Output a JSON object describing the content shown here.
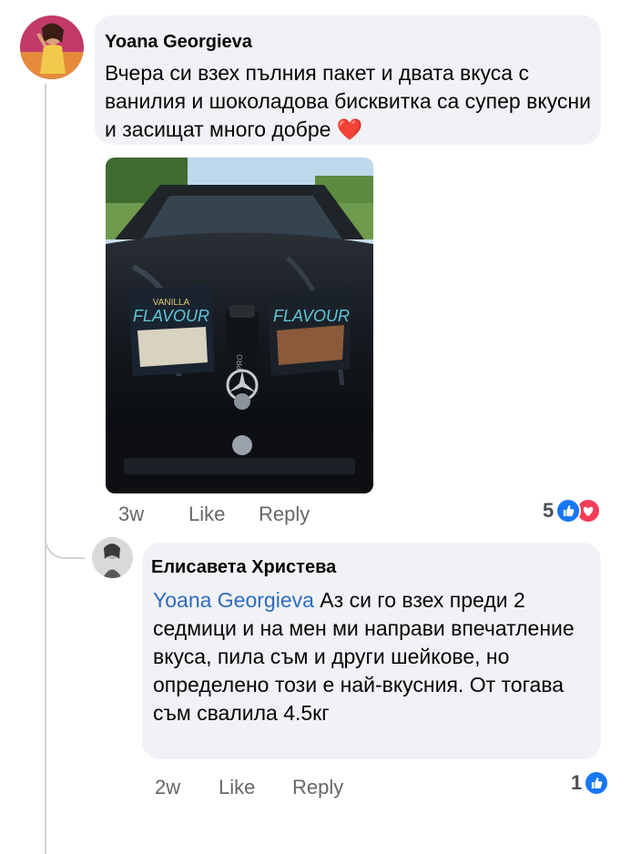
{
  "comments": [
    {
      "author": "Yoana Georgieva",
      "text": "Вчера си взех пълния пакет и двата вкуса с ванилия и шоколадова бисквитка са супер вкусни и засищат много добре",
      "emoji": "❤️",
      "time": "3w",
      "like_label": "Like",
      "reply_label": "Reply",
      "reaction_count": "5",
      "reactions": [
        "like",
        "love"
      ],
      "photo": {
        "package_left_label": "VANILLA\nFLAVOUR",
        "package_right_label": "FLAVOUR",
        "shaker_label": "PRO"
      }
    },
    {
      "author": "Елисавета Христева",
      "mention": "Yoana Georgieva",
      "text": "Аз си го взех преди 2 седмици и на мен ми направи впечатление вкуса, пила съм и други шейкове, но определено този е най-вкусния. От тогава съм свалила 4.5кг",
      "time": "2w",
      "like_label": "Like",
      "reply_label": "Reply",
      "reaction_count": "1",
      "reactions": [
        "like"
      ]
    }
  ],
  "colors": {
    "bubble_bg": "#f0f2f5",
    "mention": "#2e6bbf",
    "meta_text": "#65676b",
    "like_blue": "#1877f2",
    "love_red": "#f33e58"
  }
}
